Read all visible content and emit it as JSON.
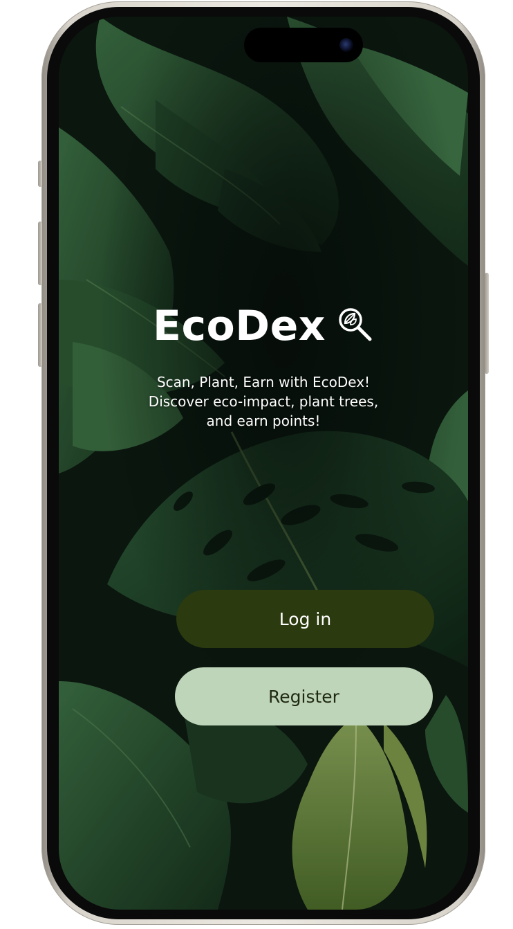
{
  "app": {
    "name": "EcoDex",
    "tagline_lines": [
      "Scan, Plant, Earn with EcoDex!",
      "Discover eco-impact, plant trees,",
      "and earn points!"
    ]
  },
  "actions": {
    "login_label": "Log in",
    "register_label": "Register"
  },
  "icons": {
    "brand": "leaf-magnifier-icon"
  },
  "colors": {
    "login_button_bg": "#2c3a0f",
    "register_button_bg": "#bfd5b9",
    "register_button_text": "#1f2a12",
    "screen_background": "#0c1710",
    "leaf_dark": "#1c3a22",
    "leaf_mid": "#2e5a34",
    "leaf_light": "#6f8f3f"
  }
}
